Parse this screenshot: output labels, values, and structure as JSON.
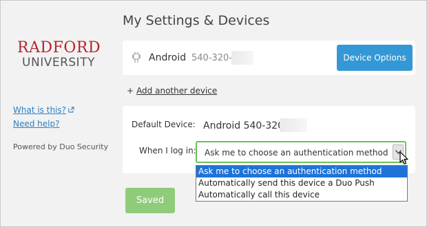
{
  "logo": {
    "line1": "RADFORD",
    "line2": "UNIVERSITY"
  },
  "sidebar": {
    "what_is_this": "What is this?",
    "need_help": "Need help?",
    "powered_by": "Powered by Duo Security"
  },
  "page": {
    "title": "My Settings & Devices"
  },
  "device": {
    "name": "Android",
    "number": "540-320-",
    "options_label": "Device Options",
    "icon": "android-icon"
  },
  "add_device": {
    "plus": "+",
    "label": "Add another device"
  },
  "settings": {
    "default_device_label": "Default Device:",
    "default_device_value": "Android 540-320-",
    "when_login_label": "When I log in:",
    "when_login_selected": "Ask me to choose an authentication method",
    "options": [
      "Ask me to choose an authentication method",
      "Automatically send this device a Duo Push",
      "Automatically call this device"
    ]
  },
  "saved_label": "Saved",
  "colors": {
    "brand_red": "#b3262e",
    "primary_blue": "#3498d6",
    "link_blue": "#2b7fc4",
    "success_green": "#8fcc7a",
    "select_border": "#6cbf5a",
    "dropdown_highlight": "#1e73d8"
  }
}
